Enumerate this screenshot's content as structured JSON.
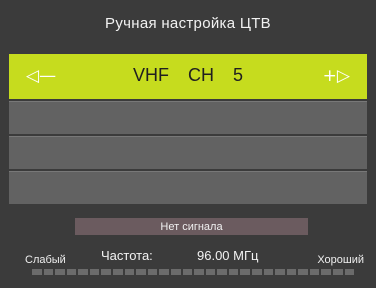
{
  "title": "Ручная настройка ЦТВ",
  "channel": {
    "left_control": "◁—",
    "band": "VHF",
    "ch_label": "CH",
    "number": "5",
    "right_control": "+▷"
  },
  "status": "Нет сигнала",
  "strength": {
    "weak_label": "Слабый",
    "strong_label": "Хороший",
    "level": 0,
    "segments": 28
  },
  "frequency": {
    "label": "Частота:",
    "value": "96.00 МГц"
  },
  "colors": {
    "accent": "#c6dc1e",
    "background": "#3b3b3b",
    "row": "#626262",
    "status_bg": "#6b5b5f"
  }
}
